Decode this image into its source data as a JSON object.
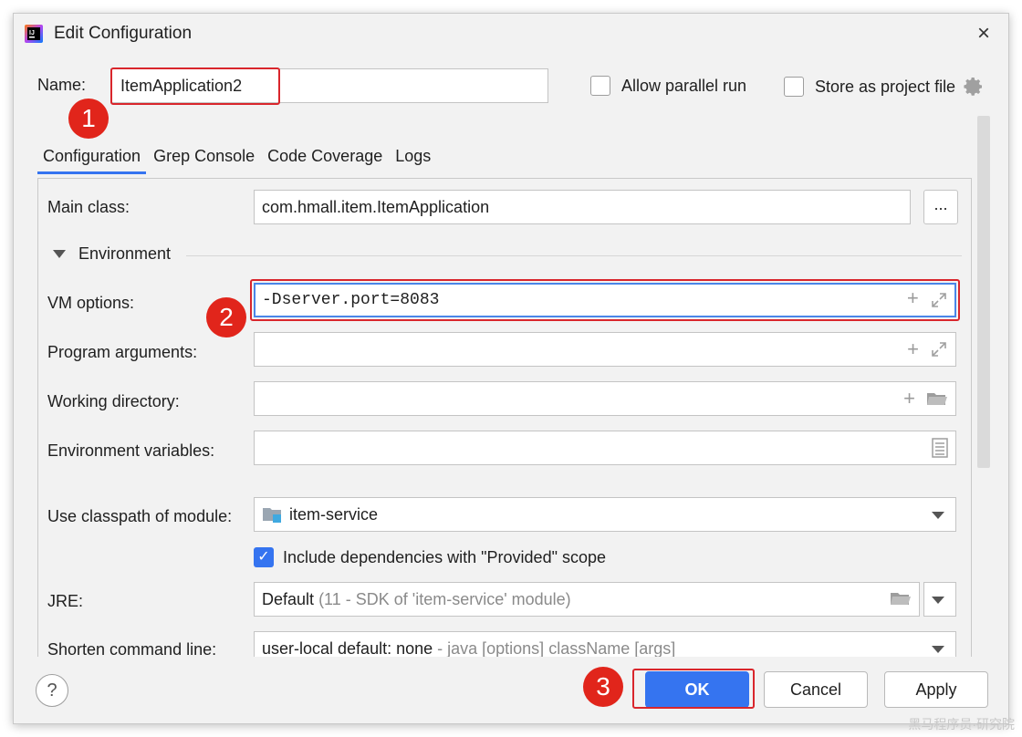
{
  "window": {
    "title": "Edit Configuration",
    "close_glyph": "×"
  },
  "name": {
    "label": "Name:",
    "value": "ItemApplication2"
  },
  "options": {
    "allow_parallel_run": "Allow parallel run",
    "store_as_project_file": "Store as project file"
  },
  "tabs": [
    {
      "label": "Configuration",
      "active": true
    },
    {
      "label": "Grep Console",
      "active": false
    },
    {
      "label": "Code Coverage",
      "active": false
    },
    {
      "label": "Logs",
      "active": false
    }
  ],
  "main_class": {
    "label": "Main class:",
    "value": "com.hmall.item.ItemApplication",
    "browse": "..."
  },
  "environment": {
    "section_label": "Environment",
    "vm_options": {
      "label": "VM options:",
      "value": "-Dserver.port=8083"
    },
    "program_arguments": {
      "label": "Program arguments:",
      "value": ""
    },
    "working_directory": {
      "label": "Working directory:",
      "value": ""
    },
    "environment_variables": {
      "label": "Environment variables:",
      "value": ""
    }
  },
  "classpath": {
    "label": "Use classpath of module:",
    "value": "item-service"
  },
  "include_provided": {
    "label": "Include dependencies with \"Provided\" scope",
    "checked": true
  },
  "jre": {
    "label": "JRE:",
    "value": "Default",
    "detail": "(11 - SDK of 'item-service' module)"
  },
  "shorten": {
    "label": "Shorten command line:",
    "value": "user-local default: none",
    "detail": " - java [options] className [args]"
  },
  "buttons": {
    "help": "?",
    "ok": "OK",
    "cancel": "Cancel",
    "apply": "Apply"
  },
  "annotations": {
    "step1": "1",
    "step2": "2",
    "step3": "3"
  },
  "watermark": "黑马程序员·研究院",
  "colors": {
    "accent": "#3574f0",
    "annotation_red": "#e1251b"
  }
}
